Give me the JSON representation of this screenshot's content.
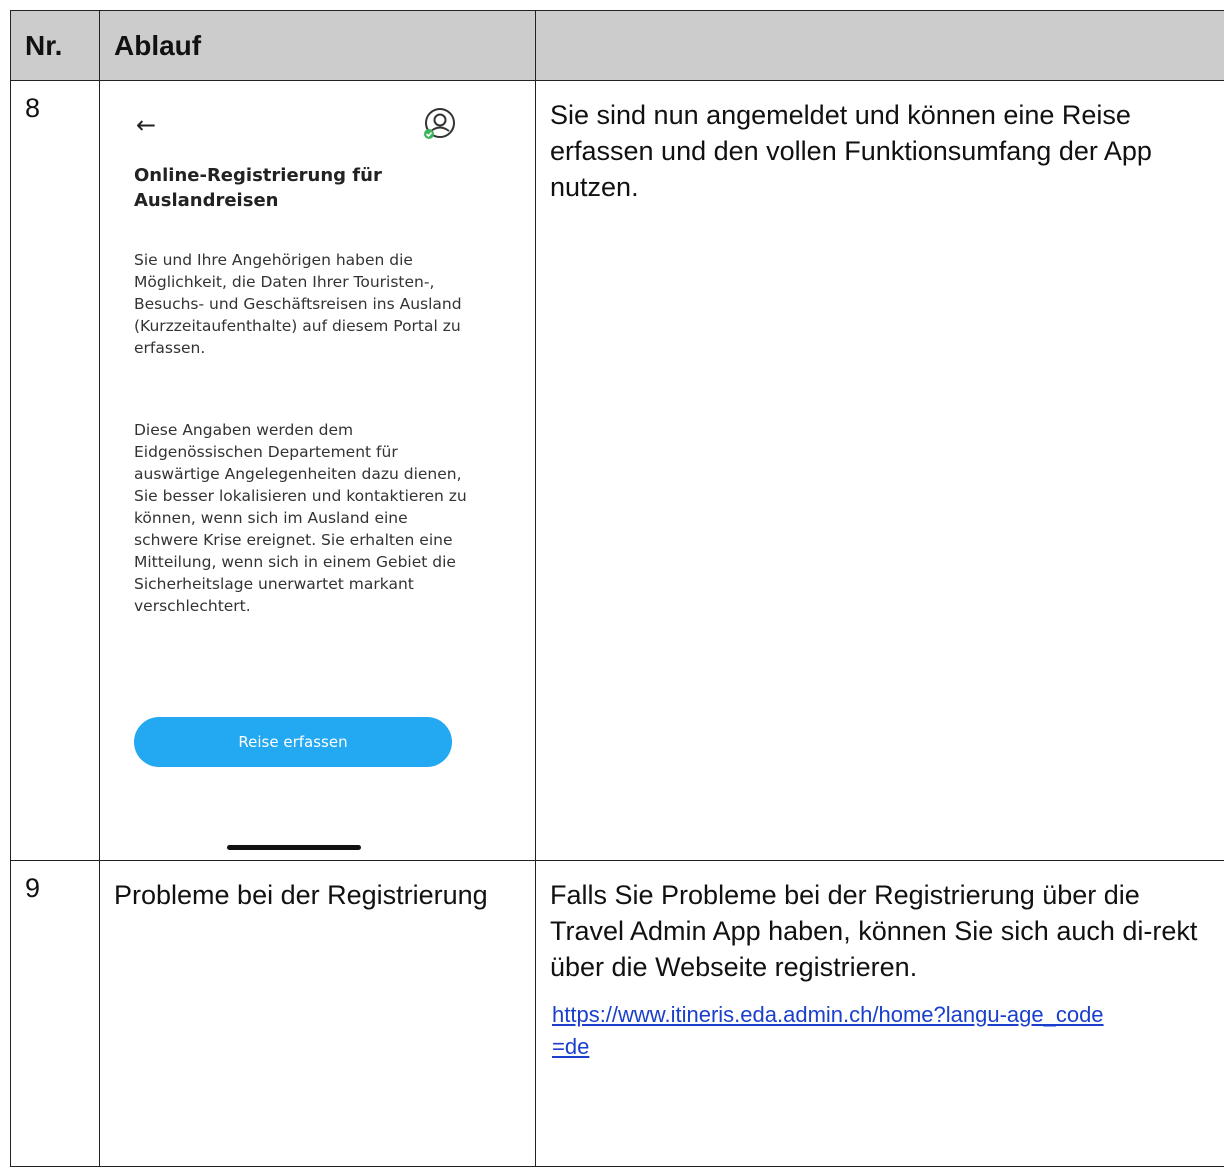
{
  "table": {
    "header": {
      "nr": "Nr.",
      "ablauf": "Ablauf",
      "desc": ""
    },
    "rows": [
      {
        "nr": "8",
        "phone": {
          "title": "Online-Registrierung für Auslandreisen",
          "para1": "Sie und Ihre Angehörigen haben die Möglichkeit, die Daten Ihrer Touristen-, Besuchs- und Geschäftsreisen ins Ausland (Kurzzeitaufenthalte) auf diesem Portal zu erfassen.",
          "para2": "Diese Angaben werden dem Eidgenössischen Departement für auswärtige Angelegenheiten dazu dienen, Sie besser lokalisieren und kontaktieren zu können, wenn sich im Ausland eine schwere Krise ereignet. Sie erhalten eine Mitteilung, wenn sich in einem Gebiet die Sicherheitslage unerwartet markant verschlechtert.",
          "button": "Reise erfassen",
          "icons": {
            "back": "back-arrow-icon",
            "profile": "user-profile-icon"
          },
          "colors": {
            "button": "#23a8f2",
            "status_dot": "#3cb35a"
          }
        },
        "desc": "Sie sind nun angemeldet und können eine Reise erfassen und den vollen Funktionsumfang der App nutzen."
      },
      {
        "nr": "9",
        "ablauf": "Probleme bei der Registrierung",
        "desc": "Falls Sie Probleme bei der Registrierung über die Travel Admin App haben, können Sie sich auch di-rekt über die Webseite registrieren.",
        "link": "https://www.itineris.eda.admin.ch/home?langu-age_code=de"
      }
    ]
  },
  "colors": {
    "header_bg": "#cccccc",
    "link": "#1a3fcc"
  }
}
